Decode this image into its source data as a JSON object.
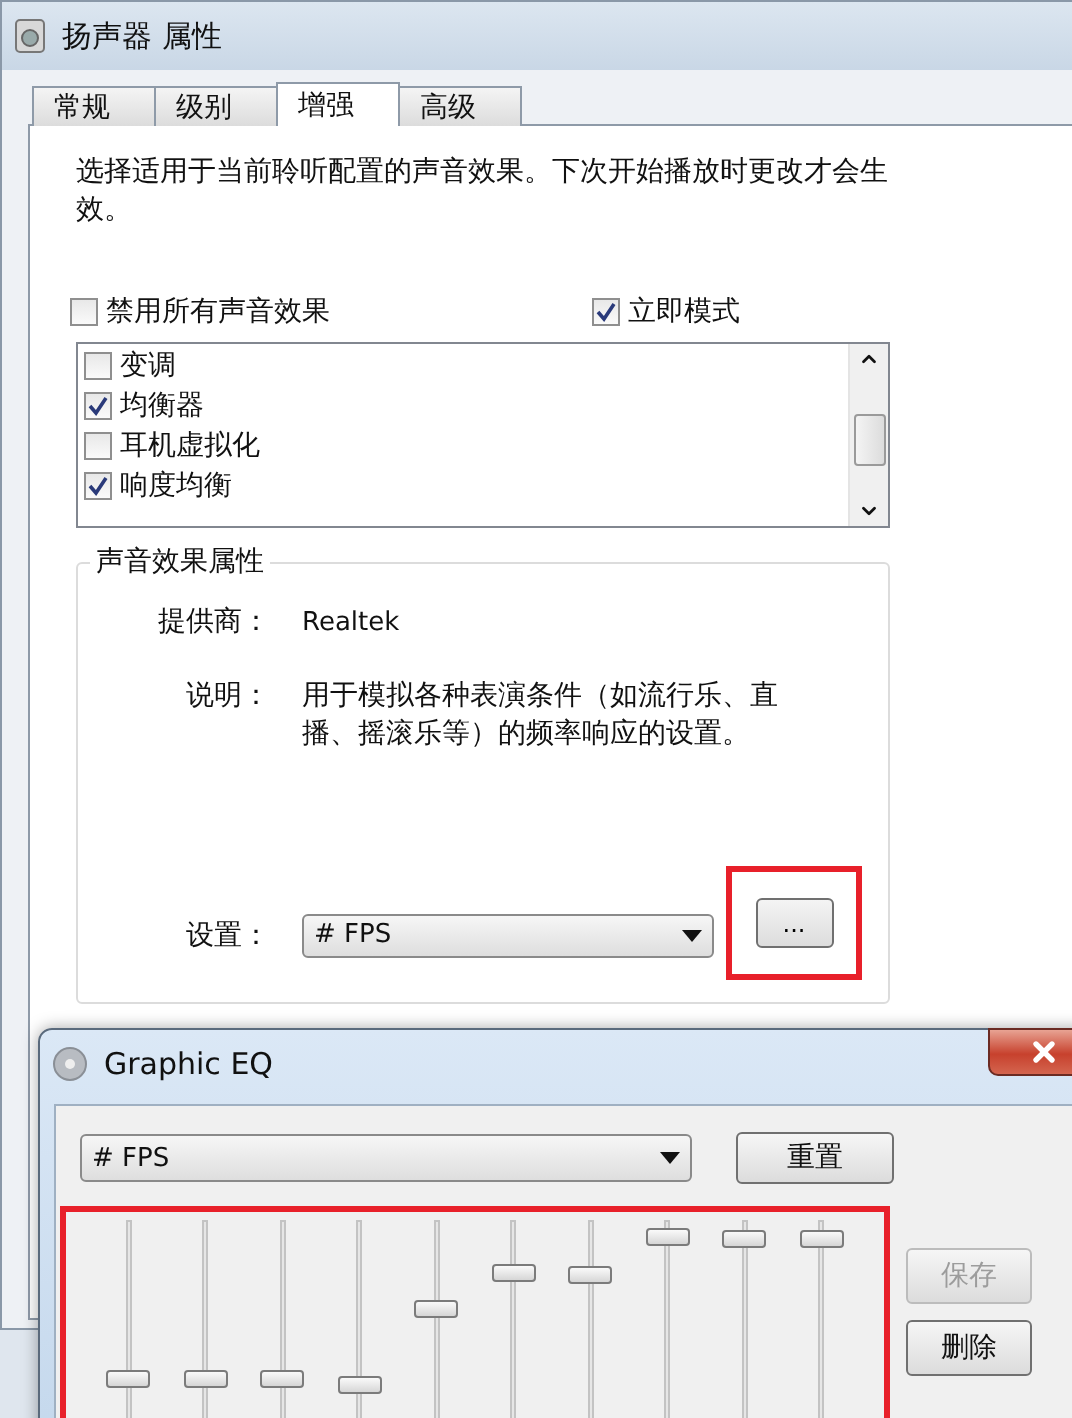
{
  "window": {
    "title": "扬声器 属性"
  },
  "tabs": [
    {
      "label": "常规",
      "selected": false
    },
    {
      "label": "级别",
      "selected": false
    },
    {
      "label": "增强",
      "selected": true
    },
    {
      "label": "高级",
      "selected": false
    }
  ],
  "intro": "选择适用于当前聆听配置的声音效果。下次开始播放时更改才会生效。",
  "options": [
    {
      "label": "禁用所有声音效果",
      "checked": false
    },
    {
      "label": "立即模式",
      "checked": true
    }
  ],
  "effects": [
    {
      "label": "变调",
      "checked": false
    },
    {
      "label": "均衡器",
      "checked": true
    },
    {
      "label": "耳机虚拟化",
      "checked": false
    },
    {
      "label": "响度均衡",
      "checked": true
    }
  ],
  "properties": {
    "title": "声音效果属性",
    "provider_label": "提供商：",
    "provider": "Realtek",
    "description_label": "说明：",
    "description": "用于模拟各种表演条件（如流行乐、直播、摇滚乐等）的频率响应的设置。",
    "setting_label": "设置：",
    "setting": "# FPS",
    "more_button": {
      "label": "...",
      "highlighted": true
    }
  },
  "eq": {
    "title": "Graphic EQ",
    "preset": "# FPS",
    "reset": "重置",
    "bands_highlighted": true,
    "bands": [
      {
        "level": 0.25
      },
      {
        "level": 0.25
      },
      {
        "level": 0.25
      },
      {
        "level": 0.22
      },
      {
        "level": 0.6
      },
      {
        "level": 0.78
      },
      {
        "level": 0.77
      },
      {
        "level": 0.96
      },
      {
        "level": 0.95
      },
      {
        "level": 0.95
      }
    ],
    "buttons": [
      {
        "label": "保存",
        "disabled": true
      },
      {
        "label": "删除",
        "disabled": false
      }
    ]
  }
}
